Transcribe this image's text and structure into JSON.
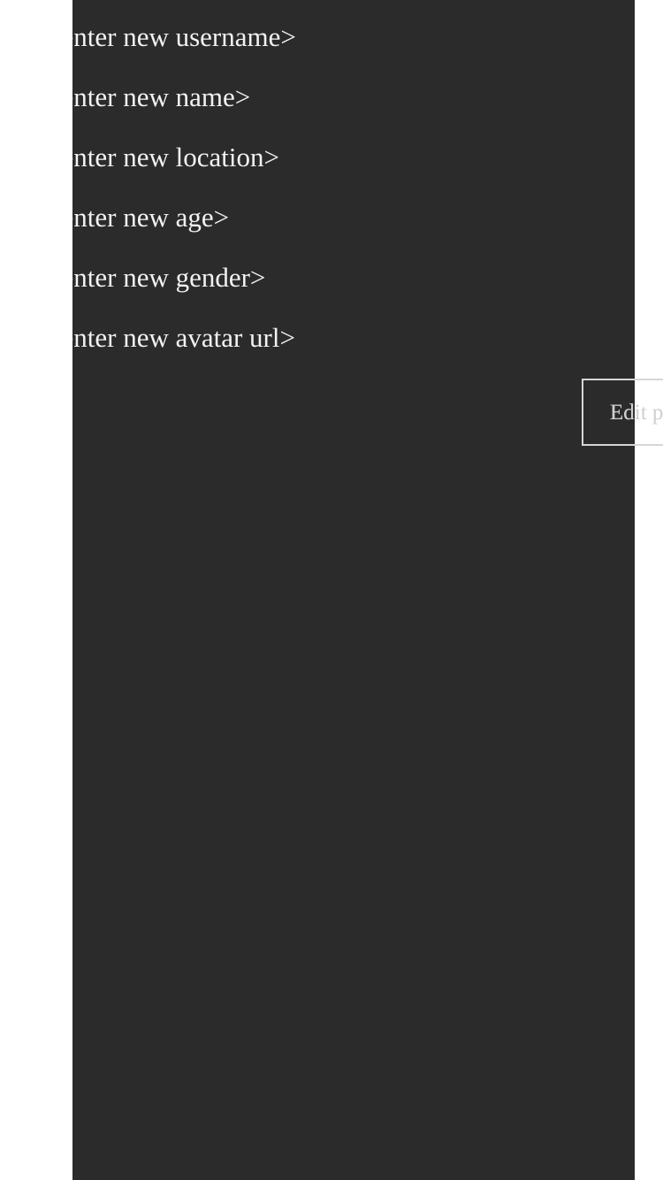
{
  "form": {
    "fields": [
      {
        "placeholder": "<enter new username>"
      },
      {
        "placeholder": "<enter new name>"
      },
      {
        "placeholder": "<enter new location>"
      },
      {
        "placeholder": "<enter new age>"
      },
      {
        "placeholder": "<enter new gender>"
      },
      {
        "placeholder": "<enter new avatar url>"
      }
    ],
    "submit_label": "Edit profile"
  },
  "colors": {
    "panel_background": "#2b2b2b",
    "page_background": "#ffffff",
    "text": "#f2f2f2"
  }
}
